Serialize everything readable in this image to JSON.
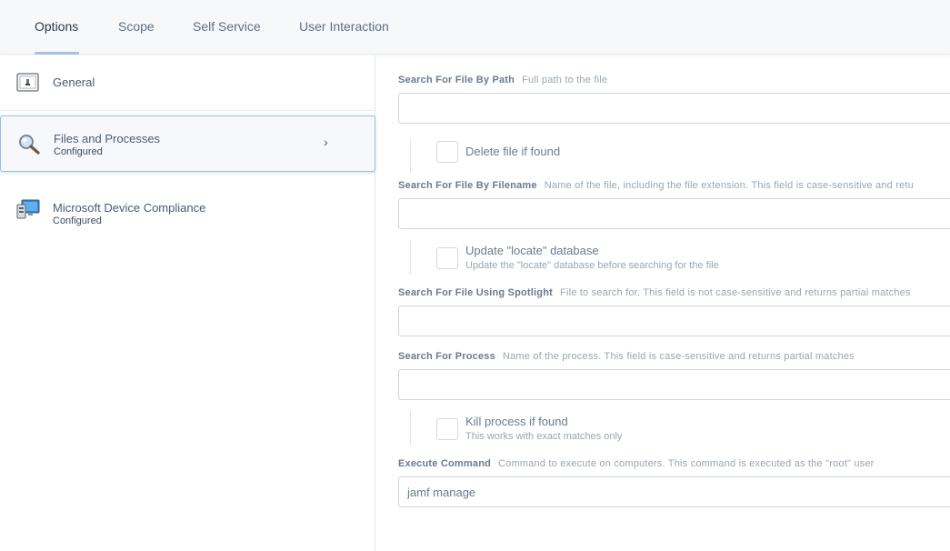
{
  "tabs": [
    {
      "label": "Options"
    },
    {
      "label": "Scope"
    },
    {
      "label": "Self Service"
    },
    {
      "label": "User Interaction"
    }
  ],
  "sidebar": {
    "items": [
      {
        "title": "General",
        "subtitle": ""
      },
      {
        "title": "Files and Processes",
        "subtitle": "Configured"
      },
      {
        "title": "Microsoft Device Compliance",
        "subtitle": "Configured"
      }
    ]
  },
  "form": {
    "path": {
      "label": "Search For File By Path",
      "hint": "Full path to the file",
      "value": ""
    },
    "delete_file": {
      "label": "Delete file if found"
    },
    "filename": {
      "label": "Search For File By Filename",
      "hint": "Name of the file, including the file extension. This field is case-sensitive and retu",
      "value": ""
    },
    "update_locate": {
      "label": "Update \"locate\" database",
      "sublabel": "Update the \"locate\" database before searching for the file"
    },
    "spotlight": {
      "label": "Search For File Using Spotlight",
      "hint": "File to search for. This field is not case-sensitive and returns partial matches",
      "value": ""
    },
    "process": {
      "label": "Search For Process",
      "hint": "Name of the process. This field is case-sensitive and returns partial matches",
      "value": ""
    },
    "kill_process": {
      "label": "Kill process if found",
      "sublabel": "This works with exact matches only"
    },
    "command": {
      "label": "Execute Command",
      "hint": "Command to execute on computers. This command is executed as the \"root\" user",
      "value": "jamf manage"
    }
  }
}
